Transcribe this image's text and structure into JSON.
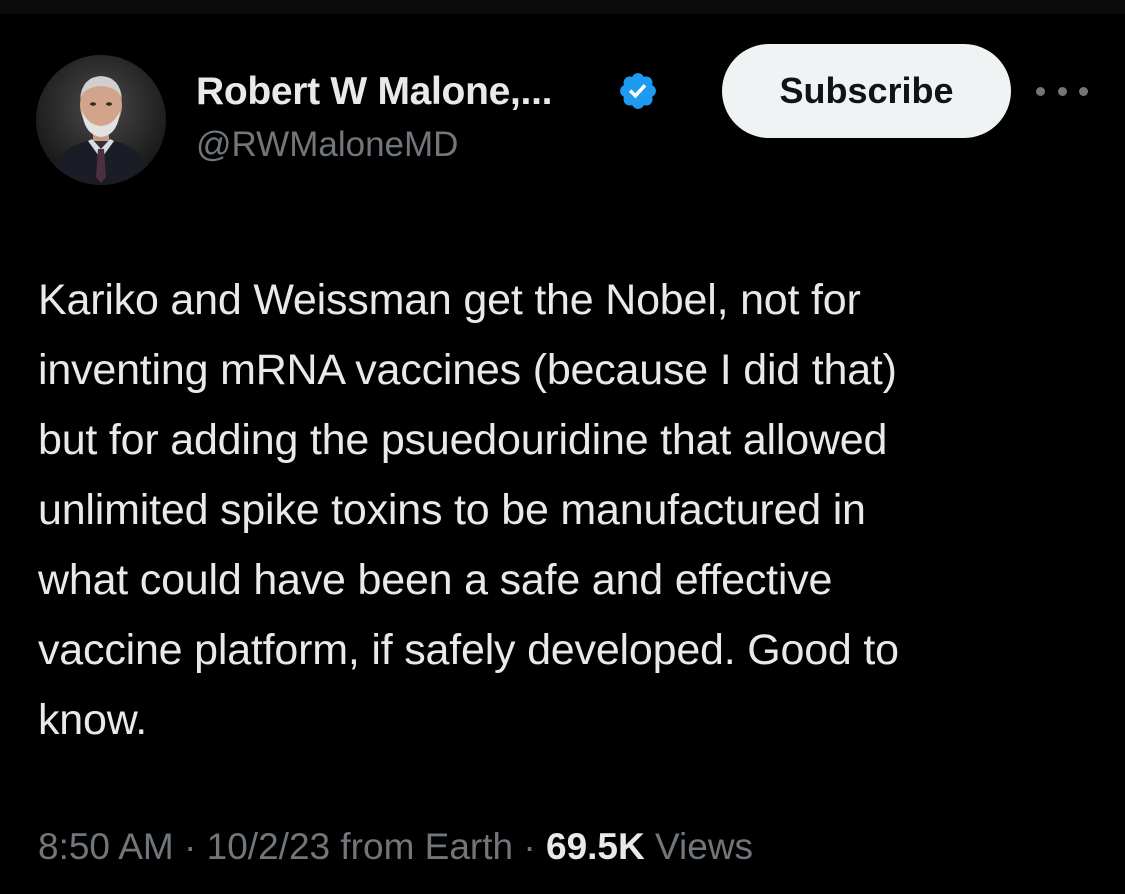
{
  "author": {
    "display_name": "Robert W Malone,...",
    "handle": "@RWMaloneMD",
    "avatar_icon": "profile-photo",
    "verified_badge_color": "#1d9bf0"
  },
  "actions": {
    "subscribe_label": "Subscribe",
    "more_icon": "more-horizontal-icon"
  },
  "tweet": {
    "text": "Kariko and Weissman get the Nobel, not for\ninventing mRNA vaccines (because I did that)\nbut for adding the psuedouridine that allowed\nunlimited spike toxins to be manufactured in\nwhat could have been a safe and effective\nvaccine platform, if safely developed.  Good to\nknow."
  },
  "meta": {
    "time": "8:50 AM",
    "separator": "·",
    "date": "10/2/23",
    "source": "from Earth",
    "views_count": "69.5K",
    "views_label": "Views"
  },
  "colors": {
    "background": "#000000",
    "primary_text": "#e7e9ea",
    "secondary_text": "#71767b",
    "button_bg": "#eff3f4"
  }
}
